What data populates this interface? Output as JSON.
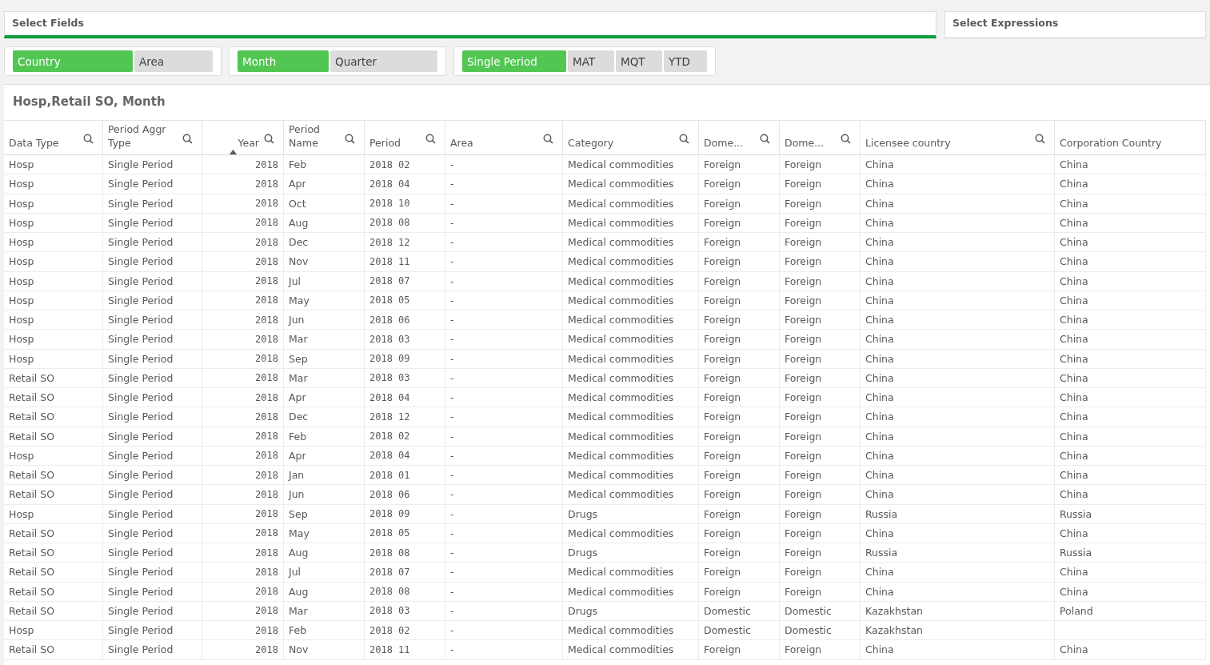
{
  "tabs": [
    {
      "label": "Select Fields",
      "selected": true
    },
    {
      "label": "Select Expressions",
      "selected": false
    }
  ],
  "toggle_groups": [
    {
      "options": [
        {
          "label": "Country",
          "selected": true
        },
        {
          "label": "Area",
          "selected": false
        }
      ]
    },
    {
      "options": [
        {
          "label": "Month",
          "selected": true
        },
        {
          "label": "Quarter",
          "selected": false
        }
      ]
    },
    {
      "options": [
        {
          "label": "Single Period",
          "selected": true
        },
        {
          "label": "MAT",
          "selected": false
        },
        {
          "label": "MQT",
          "selected": false
        },
        {
          "label": "YTD",
          "selected": false
        }
      ]
    }
  ],
  "table": {
    "title": "Hosp,Retail SO, Month",
    "columns": [
      {
        "label": "Data Type",
        "searchable": true,
        "sorted": false,
        "kind": "text"
      },
      {
        "label": "Period Aggr Type",
        "searchable": true,
        "sorted": false,
        "kind": "text"
      },
      {
        "label": "Year",
        "searchable": true,
        "sorted": true,
        "kind": "number"
      },
      {
        "label": "Period Name",
        "searchable": true,
        "sorted": false,
        "kind": "text"
      },
      {
        "label": "Period",
        "searchable": true,
        "sorted": false,
        "kind": "code"
      },
      {
        "label": "Area",
        "searchable": true,
        "sorted": false,
        "kind": "text"
      },
      {
        "label": "Category",
        "searchable": true,
        "sorted": false,
        "kind": "text"
      },
      {
        "label": "Dome...",
        "searchable": true,
        "sorted": false,
        "kind": "text"
      },
      {
        "label": "Dome...",
        "searchable": true,
        "sorted": false,
        "kind": "text"
      },
      {
        "label": "Licensee country",
        "searchable": true,
        "sorted": false,
        "kind": "text"
      },
      {
        "label": "Corporation Country",
        "searchable": false,
        "sorted": false,
        "kind": "text"
      }
    ],
    "rows": [
      [
        "Hosp",
        "Single Period",
        "2018",
        "Feb",
        "2018 02",
        "-",
        "Medical commodities",
        "Foreign",
        "Foreign",
        "China",
        "China"
      ],
      [
        "Hosp",
        "Single Period",
        "2018",
        "Apr",
        "2018 04",
        "-",
        "Medical commodities",
        "Foreign",
        "Foreign",
        "China",
        "China"
      ],
      [
        "Hosp",
        "Single Period",
        "2018",
        "Oct",
        "2018 10",
        "-",
        "Medical commodities",
        "Foreign",
        "Foreign",
        "China",
        "China"
      ],
      [
        "Hosp",
        "Single Period",
        "2018",
        "Aug",
        "2018 08",
        "-",
        "Medical commodities",
        "Foreign",
        "Foreign",
        "China",
        "China"
      ],
      [
        "Hosp",
        "Single Period",
        "2018",
        "Dec",
        "2018 12",
        "-",
        "Medical commodities",
        "Foreign",
        "Foreign",
        "China",
        "China"
      ],
      [
        "Hosp",
        "Single Period",
        "2018",
        "Nov",
        "2018 11",
        "-",
        "Medical commodities",
        "Foreign",
        "Foreign",
        "China",
        "China"
      ],
      [
        "Hosp",
        "Single Period",
        "2018",
        "Jul",
        "2018 07",
        "-",
        "Medical commodities",
        "Foreign",
        "Foreign",
        "China",
        "China"
      ],
      [
        "Hosp",
        "Single Period",
        "2018",
        "May",
        "2018 05",
        "-",
        "Medical commodities",
        "Foreign",
        "Foreign",
        "China",
        "China"
      ],
      [
        "Hosp",
        "Single Period",
        "2018",
        "Jun",
        "2018 06",
        "-",
        "Medical commodities",
        "Foreign",
        "Foreign",
        "China",
        "China"
      ],
      [
        "Hosp",
        "Single Period",
        "2018",
        "Mar",
        "2018 03",
        "-",
        "Medical commodities",
        "Foreign",
        "Foreign",
        "China",
        "China"
      ],
      [
        "Hosp",
        "Single Period",
        "2018",
        "Sep",
        "2018 09",
        "-",
        "Medical commodities",
        "Foreign",
        "Foreign",
        "China",
        "China"
      ],
      [
        "Retail SO",
        "Single Period",
        "2018",
        "Mar",
        "2018 03",
        "-",
        "Medical commodities",
        "Foreign",
        "Foreign",
        "China",
        "China"
      ],
      [
        "Retail SO",
        "Single Period",
        "2018",
        "Apr",
        "2018 04",
        "-",
        "Medical commodities",
        "Foreign",
        "Foreign",
        "China",
        "China"
      ],
      [
        "Retail SO",
        "Single Period",
        "2018",
        "Dec",
        "2018 12",
        "-",
        "Medical commodities",
        "Foreign",
        "Foreign",
        "China",
        "China"
      ],
      [
        "Retail SO",
        "Single Period",
        "2018",
        "Feb",
        "2018 02",
        "-",
        "Medical commodities",
        "Foreign",
        "Foreign",
        "China",
        "China"
      ],
      [
        "Hosp",
        "Single Period",
        "2018",
        "Apr",
        "2018 04",
        "-",
        "Medical commodities",
        "Foreign",
        "Foreign",
        "China",
        "China"
      ],
      [
        "Retail SO",
        "Single Period",
        "2018",
        "Jan",
        "2018 01",
        "-",
        "Medical commodities",
        "Foreign",
        "Foreign",
        "China",
        "China"
      ],
      [
        "Retail SO",
        "Single Period",
        "2018",
        "Jun",
        "2018 06",
        "-",
        "Medical commodities",
        "Foreign",
        "Foreign",
        "China",
        "China"
      ],
      [
        "Hosp",
        "Single Period",
        "2018",
        "Sep",
        "2018 09",
        "-",
        "Drugs",
        "Foreign",
        "Foreign",
        "Russia",
        "Russia"
      ],
      [
        "Retail SO",
        "Single Period",
        "2018",
        "May",
        "2018 05",
        "-",
        "Medical commodities",
        "Foreign",
        "Foreign",
        "China",
        "China"
      ],
      [
        "Retail SO",
        "Single Period",
        "2018",
        "Aug",
        "2018 08",
        "-",
        "Drugs",
        "Foreign",
        "Foreign",
        "Russia",
        "Russia"
      ],
      [
        "Retail SO",
        "Single Period",
        "2018",
        "Jul",
        "2018 07",
        "-",
        "Medical commodities",
        "Foreign",
        "Foreign",
        "China",
        "China"
      ],
      [
        "Retail SO",
        "Single Period",
        "2018",
        "Aug",
        "2018 08",
        "-",
        "Medical commodities",
        "Foreign",
        "Foreign",
        "China",
        "China"
      ],
      [
        "Retail SO",
        "Single Period",
        "2018",
        "Mar",
        "2018 03",
        "-",
        "Drugs",
        "Domestic",
        "Domestic",
        "Kazakhstan",
        "Poland"
      ],
      [
        "Hosp",
        "Single Period",
        "2018",
        "Feb",
        "2018 02",
        "-",
        "Medical commodities",
        "Domestic",
        "Domestic",
        "Kazakhstan",
        null
      ],
      [
        "Retail SO",
        "Single Period",
        "2018",
        "Nov",
        "2018 11",
        "-",
        "Medical commodities",
        "Foreign",
        "Foreign",
        "China",
        "China"
      ]
    ]
  }
}
